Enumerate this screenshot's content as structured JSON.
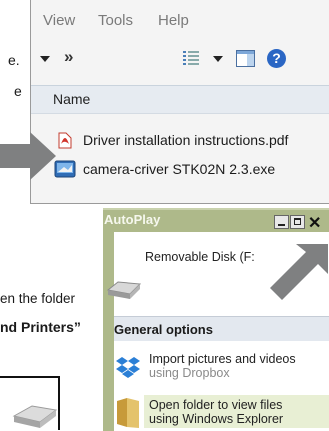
{
  "doc": {
    "line1_suffix": "e.",
    "line2_suffix": "e",
    "line3_partial": "en the folder",
    "line4_partial": "nd Printers”"
  },
  "explorer": {
    "menu": [
      "View",
      "Tools",
      "Help"
    ],
    "toolbar": {
      "overflow": "»",
      "help": "?"
    },
    "column_header": "Name",
    "files": [
      {
        "name": "Driver installation instructions.pdf",
        "icon": "pdf-icon"
      },
      {
        "name": "camera-criver STK02N 2.3.exe",
        "icon": "installer-exe-icon"
      }
    ]
  },
  "autoplay": {
    "title": "AutoPlay",
    "drive_label": "Removable Disk (F:",
    "section_header": "General options",
    "options": [
      {
        "title": "Import pictures and videos",
        "subtitle": "using Dropbox",
        "icon": "dropbox-icon"
      },
      {
        "title": "Open folder to view files",
        "subtitle": "using Windows Explorer",
        "icon": "folder-icon"
      }
    ]
  },
  "colors": {
    "arrow": "#7f8081",
    "autoplay_frame": "#aeb98a",
    "header_bg": "#e6ebf1",
    "dropbox": "#2b7fd6"
  }
}
